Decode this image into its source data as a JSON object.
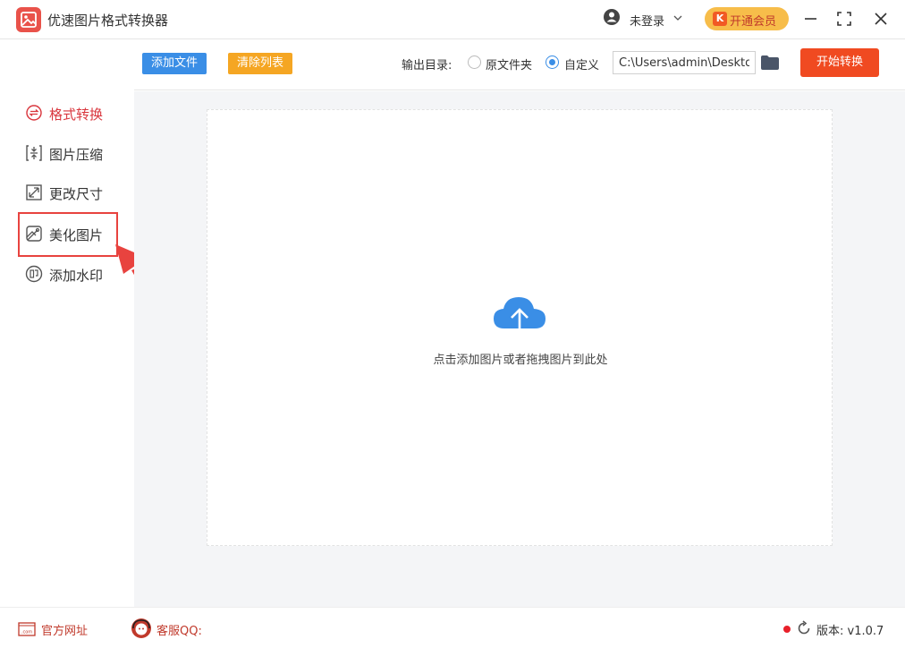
{
  "app": {
    "title": "优速图片格式转换器"
  },
  "header": {
    "login_label": "未登录",
    "vip_label": "开通会员",
    "vip_badge": "K"
  },
  "sidebar": {
    "items": [
      {
        "label": "格式转换",
        "icon": "format-convert-icon",
        "active": true
      },
      {
        "label": "图片压缩",
        "icon": "compress-icon",
        "active": false
      },
      {
        "label": "更改尺寸",
        "icon": "resize-icon",
        "active": false
      },
      {
        "label": "美化图片",
        "icon": "beautify-icon",
        "active": false,
        "highlighted": true
      },
      {
        "label": "添加水印",
        "icon": "watermark-icon",
        "active": false
      }
    ]
  },
  "toolbar": {
    "add_file_label": "添加文件",
    "clear_list_label": "清除列表",
    "output_dir_label": "输出目录:",
    "radio_original_label": "原文件夹",
    "radio_custom_label": "自定义",
    "selected_output": "自定义",
    "path_value": "C:\\Users\\admin\\Deskto",
    "start_label": "开始转换"
  },
  "main": {
    "drop_hint": "点击添加图片或者拖拽图片到此处"
  },
  "footer": {
    "site_label": "官方网址",
    "site_icon_text": ".com",
    "cs_label": "客服QQ:",
    "version_label": "版本: v1.0.7"
  },
  "colors": {
    "accent_blue": "#3a8ee6",
    "accent_orange": "#f5a623",
    "start_red": "#f04a21",
    "active_red": "#d9373e",
    "annotation_red": "#e8433f",
    "vip_yellow": "#f7bd4a"
  }
}
